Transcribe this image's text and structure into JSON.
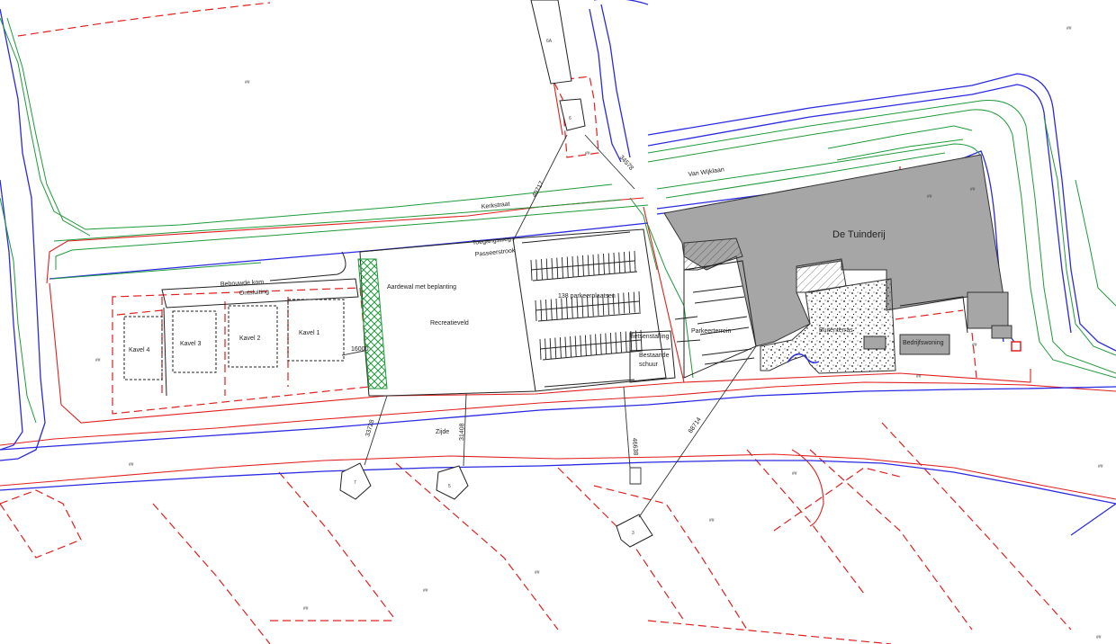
{
  "building_name": "De Tuinderij",
  "roads": {
    "kerkstraat": "Kerkstraat",
    "van_wijk_laan": "Van Wijklaan",
    "zijde": "Zijde"
  },
  "plan_labels": {
    "aardewal": "Aardewal met beplanting",
    "recreatieveld": "Recreatieveld",
    "parkeerplaatsen": "138 parkeerplaatsen",
    "fietsenstalling": "fietsenstalling",
    "bestaande_schuur_1": "Bestaande",
    "bestaande_schuur_2": "schuur",
    "parkeerterrein": "Parkeerterrein",
    "bedrijfswoning": "Bedrijfswoning",
    "buitenterras": "Buitenterras",
    "toegangsweg": "Toegangsweg",
    "passeerstrook": "Passeerstrook",
    "ontsluiting": "Ontsluiting",
    "bebouwde_kom": "Bebouwde kom"
  },
  "kavels": [
    "Kavel 1",
    "Kavel 2",
    "Kavel 3",
    "Kavel 4"
  ],
  "house_numbers": {
    "h6a": "6A",
    "h6": "6",
    "h7": "7",
    "h5": "5",
    "h3": "3"
  },
  "distances": {
    "d1": "33728",
    "d2": "31408",
    "d3": "46638",
    "d4": "88714",
    "d5": "40717",
    "d6": "34578",
    "d7": "16000"
  },
  "colors": {
    "cadastral": "#e02020",
    "water": "#2a2ae0",
    "green_edge": "#1f9a3a",
    "building": "#a6a6a6"
  }
}
